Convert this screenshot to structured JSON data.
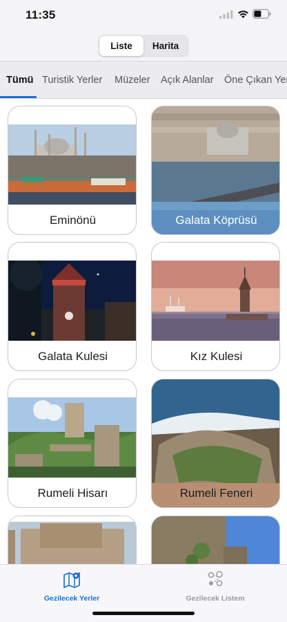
{
  "status": {
    "time": "11:35"
  },
  "segment": {
    "options": [
      "Liste",
      "Harita"
    ],
    "selected": "Liste"
  },
  "tabs": [
    "Tümü",
    "Turistik Yerler",
    "Müzeler",
    "Açık Alanlar",
    "Öne Çıkan Yerler"
  ],
  "active_tab": "Tümü",
  "places": [
    {
      "name": "Eminönü"
    },
    {
      "name": "Galata Köprüsü"
    },
    {
      "name": "Galata Kulesi"
    },
    {
      "name": "Kız Kulesi"
    },
    {
      "name": "Rumeli Hisarı"
    },
    {
      "name": "Rumeli Feneri"
    }
  ],
  "bottom_nav": {
    "items": [
      {
        "label": "Gezilecek Yerler",
        "icon": "map-icon",
        "active": true
      },
      {
        "label": "Gezilecek Listem",
        "icon": "route-list-icon",
        "active": false
      }
    ]
  },
  "colors": {
    "accent": "#1a6fd0",
    "inactive": "#9a9a9f"
  }
}
